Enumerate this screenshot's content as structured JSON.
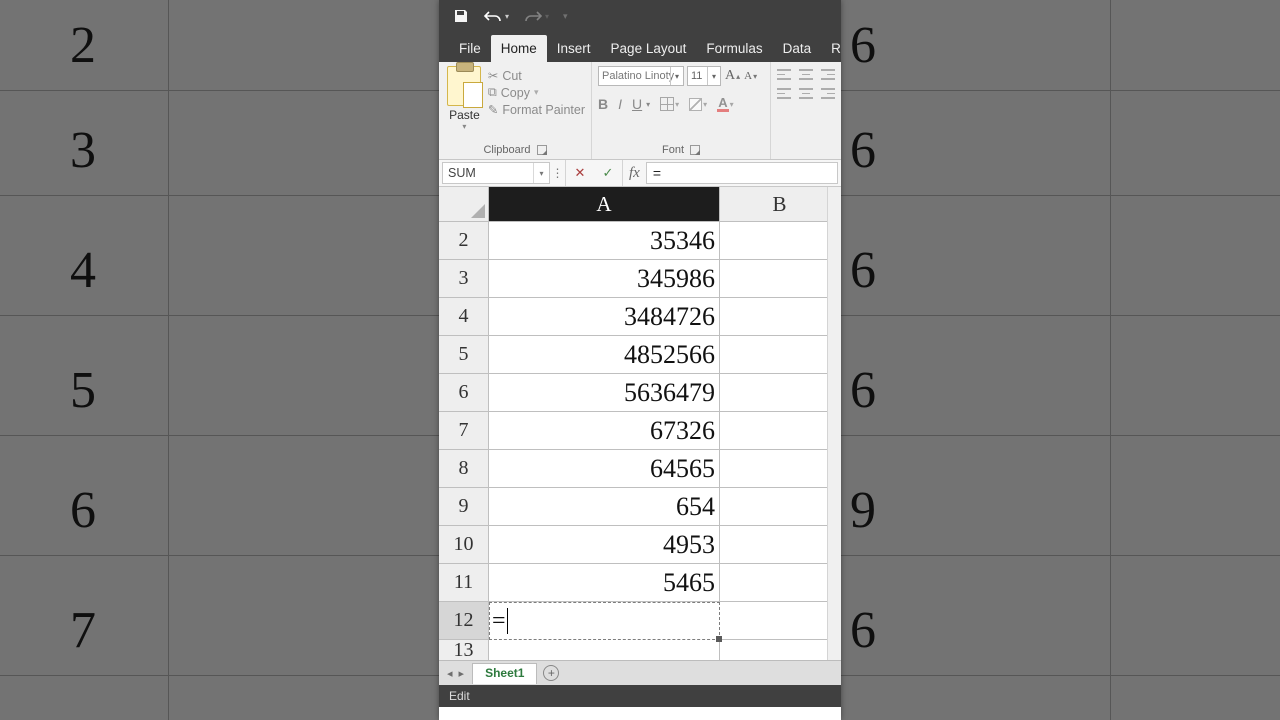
{
  "bg_rows": [
    "2",
    "3",
    "4",
    "5",
    "6",
    "7"
  ],
  "bg_right_vals": [
    "6",
    "6",
    "6",
    "6",
    "9",
    "6"
  ],
  "qat": {
    "save": "save",
    "undo": "undo",
    "redo": "redo"
  },
  "tabs": {
    "file": "File",
    "home": "Home",
    "insert": "Insert",
    "pagelayout": "Page Layout",
    "formulas": "Formulas",
    "data": "Data",
    "review": "Re"
  },
  "ribbon": {
    "clipboard": {
      "title": "Clipboard",
      "paste": "Paste",
      "cut": "Cut",
      "copy": "Copy",
      "painter": "Format Painter"
    },
    "font": {
      "title": "Font",
      "name": "Palatino Linoty",
      "size": "11",
      "grow": "A",
      "shrink": "A",
      "bold": "B",
      "italic": "I",
      "underline": "U",
      "fontcolor": "A"
    }
  },
  "namebox": "SUM",
  "fx": {
    "label": "fx",
    "value": "="
  },
  "columns": {
    "A": "A",
    "B": "B"
  },
  "rows": [
    {
      "n": "2",
      "A": "35346",
      "B": ""
    },
    {
      "n": "3",
      "A": "345986",
      "B": ""
    },
    {
      "n": "4",
      "A": "3484726",
      "B": ""
    },
    {
      "n": "5",
      "A": "4852566",
      "B": ""
    },
    {
      "n": "6",
      "A": "5636479",
      "B": ""
    },
    {
      "n": "7",
      "A": "67326",
      "B": ""
    },
    {
      "n": "8",
      "A": "64565",
      "B": ""
    },
    {
      "n": "9",
      "A": "654",
      "B": ""
    },
    {
      "n": "10",
      "A": "4953",
      "B": ""
    },
    {
      "n": "11",
      "A": "5465",
      "B": ""
    }
  ],
  "activeRow": {
    "n": "12",
    "A": "="
  },
  "partialRow": {
    "n": "13"
  },
  "sheet": {
    "name": "Sheet1"
  },
  "status": "Edit"
}
